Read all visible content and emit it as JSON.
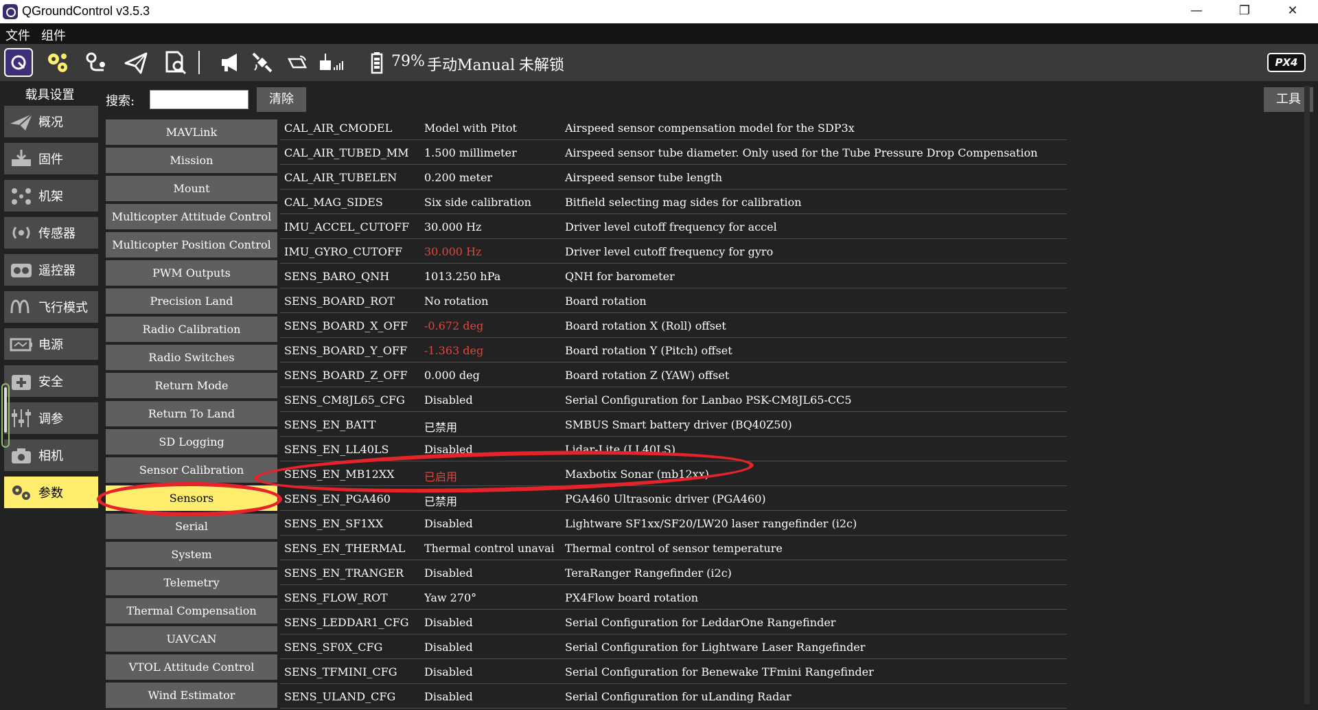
{
  "window": {
    "title": "QGroundControl v3.5.3",
    "minimize": "—",
    "maximize": "❐",
    "close": "✕"
  },
  "menu": [
    "文件",
    "组件"
  ],
  "toolbar": {
    "battery": "79%",
    "flight_mode": "手动Manual",
    "arm_status": "未解锁",
    "logo": "PX4"
  },
  "sidebar": {
    "header": "载具设置",
    "items": [
      {
        "label": "概况",
        "icon": "plane-icon"
      },
      {
        "label": "固件",
        "icon": "firmware-icon"
      },
      {
        "label": "机架",
        "icon": "airframe-icon"
      },
      {
        "label": "传感器",
        "icon": "sensors-icon"
      },
      {
        "label": "遥控器",
        "icon": "radio-icon"
      },
      {
        "label": "飞行模式",
        "icon": "flight-modes-icon"
      },
      {
        "label": "电源",
        "icon": "power-icon"
      },
      {
        "label": "安全",
        "icon": "safety-icon"
      },
      {
        "label": "调参",
        "icon": "tuning-icon"
      },
      {
        "label": "相机",
        "icon": "camera-icon"
      },
      {
        "label": "参数",
        "icon": "gears-icon"
      }
    ],
    "active_index": 10
  },
  "search": {
    "label": "搜索:",
    "value": "",
    "clear_label": "清除"
  },
  "tools_label": "工具",
  "groups": [
    "MAVLink",
    "Mission",
    "Mount",
    "Multicopter Attitude Control",
    "Multicopter Position Control",
    "PWM Outputs",
    "Precision Land",
    "Radio Calibration",
    "Radio Switches",
    "Return Mode",
    "Return To Land",
    "SD Logging",
    "Sensor Calibration",
    "Sensors",
    "Serial",
    "System",
    "Telemetry",
    "Thermal Compensation",
    "UAVCAN",
    "VTOL Attitude Control",
    "Wind Estimator"
  ],
  "selected_group": "Sensors",
  "parameters": [
    {
      "name": "CAL_AIR_CMODEL",
      "value": "Model with Pitot",
      "desc": "Airspeed sensor compensation model for the SDP3x",
      "modified": false
    },
    {
      "name": "CAL_AIR_TUBED_MM",
      "value": "1.500 millimeter",
      "desc": "Airspeed sensor tube diameter. Only used for the Tube Pressure Drop Compensation",
      "modified": false
    },
    {
      "name": "CAL_AIR_TUBELEN",
      "value": "0.200 meter",
      "desc": "Airspeed sensor tube length",
      "modified": false
    },
    {
      "name": "CAL_MAG_SIDES",
      "value": "Six side calibration",
      "desc": "Bitfield selecting mag sides for calibration",
      "modified": false
    },
    {
      "name": "IMU_ACCEL_CUTOFF",
      "value": "30.000 Hz",
      "desc": "Driver level cutoff frequency for accel",
      "modified": false
    },
    {
      "name": "IMU_GYRO_CUTOFF",
      "value": "30.000 Hz",
      "desc": "Driver level cutoff frequency for gyro",
      "modified": true
    },
    {
      "name": "SENS_BARO_QNH",
      "value": "1013.250 hPa",
      "desc": "QNH for barometer",
      "modified": false
    },
    {
      "name": "SENS_BOARD_ROT",
      "value": "No rotation",
      "desc": "Board rotation",
      "modified": false
    },
    {
      "name": "SENS_BOARD_X_OFF",
      "value": "-0.672 deg",
      "desc": "Board rotation X (Roll) offset",
      "modified": true
    },
    {
      "name": "SENS_BOARD_Y_OFF",
      "value": "-1.363 deg",
      "desc": "Board rotation Y (Pitch) offset",
      "modified": true
    },
    {
      "name": "SENS_BOARD_Z_OFF",
      "value": "0.000 deg",
      "desc": "Board rotation Z (YAW) offset",
      "modified": false
    },
    {
      "name": "SENS_CM8JL65_CFG",
      "value": "Disabled",
      "desc": "Serial Configuration for Lanbao PSK-CM8JL65-CC5",
      "modified": false
    },
    {
      "name": "SENS_EN_BATT",
      "value": "已禁用",
      "desc": "SMBUS Smart battery driver (BQ40Z50)",
      "modified": false
    },
    {
      "name": "SENS_EN_LL40LS",
      "value": "Disabled",
      "desc": "Lidar-Lite (LL40LS)",
      "modified": false
    },
    {
      "name": "SENS_EN_MB12XX",
      "value": "已启用",
      "desc": "Maxbotix Sonar (mb12xx)",
      "modified": true
    },
    {
      "name": "SENS_EN_PGA460",
      "value": "已禁用",
      "desc": "PGA460 Ultrasonic driver (PGA460)",
      "modified": false
    },
    {
      "name": "SENS_EN_SF1XX",
      "value": "Disabled",
      "desc": "Lightware SF1xx/SF20/LW20 laser rangefinder (i2c)",
      "modified": false
    },
    {
      "name": "SENS_EN_THERMAL",
      "value": "Thermal control unavai",
      "desc": "Thermal control of sensor temperature",
      "modified": false
    },
    {
      "name": "SENS_EN_TRANGER",
      "value": "Disabled",
      "desc": "TeraRanger Rangefinder (i2c)",
      "modified": false
    },
    {
      "name": "SENS_FLOW_ROT",
      "value": "Yaw 270°",
      "desc": "PX4Flow board rotation",
      "modified": false
    },
    {
      "name": "SENS_LEDDAR1_CFG",
      "value": "Disabled",
      "desc": "Serial Configuration for LeddarOne Rangefinder",
      "modified": false
    },
    {
      "name": "SENS_SF0X_CFG",
      "value": "Disabled",
      "desc": "Serial Configuration for Lightware Laser Rangefinder",
      "modified": false
    },
    {
      "name": "SENS_TFMINI_CFG",
      "value": "Disabled",
      "desc": "Serial Configuration for Benewake TFmini Rangefinder",
      "modified": false
    },
    {
      "name": "SENS_ULAND_CFG",
      "value": "Disabled",
      "desc": "Serial Configuration for uLanding Radar",
      "modified": false
    }
  ],
  "colors": {
    "accent": "#ffee6e",
    "modified_value": "#e8443a",
    "annotation": "#e6222b",
    "home_button": "#3f2e78"
  }
}
